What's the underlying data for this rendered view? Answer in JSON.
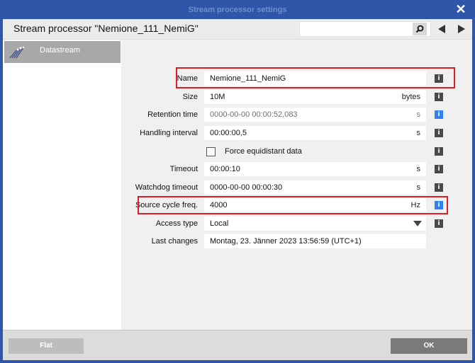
{
  "window": {
    "title": "Stream processor settings",
    "close_glyph": "✕"
  },
  "header": {
    "title": "Stream processor \"Nemione_111_NemiG\"",
    "search_placeholder": ""
  },
  "sidebar": {
    "items": [
      {
        "label": "Datastream",
        "icon": "datastream-icon",
        "selected": true
      }
    ]
  },
  "fields": {
    "name": {
      "label": "Name",
      "value": "Nemione_111_NemiG",
      "unit": ""
    },
    "size": {
      "label": "Size",
      "value": "10M",
      "unit": "bytes"
    },
    "retention": {
      "label": "Retention time",
      "value": "0000-00-00 00:00:52,083",
      "unit": "s"
    },
    "handling": {
      "label": "Handling interval",
      "value": "00:00:00,5",
      "unit": "s"
    },
    "equidistant": {
      "label": "Force equidistant data",
      "checked": false
    },
    "timeout": {
      "label": "Timeout",
      "value": "00:00:10",
      "unit": "s"
    },
    "watchdog": {
      "label": "Watchdog timeout",
      "value": "0000-00-00 00:00:30",
      "unit": "s"
    },
    "source_cycle": {
      "label": "Source cycle freq.",
      "value": "4000",
      "unit": "Hz"
    },
    "access_type": {
      "label": "Access type",
      "value": "Local"
    },
    "last_changes": {
      "label": "Last changes",
      "value": "Montag, 23. Jänner 2023   13:56:59 (UTC+1)"
    }
  },
  "info_glyph": "i",
  "footer": {
    "flat_label": "Flat",
    "ok_label": "OK"
  },
  "colors": {
    "window_frame": "#2f56a8",
    "highlight": "#e01c24",
    "info_active": "#2f80f0",
    "info_default": "#4a4a4a"
  }
}
